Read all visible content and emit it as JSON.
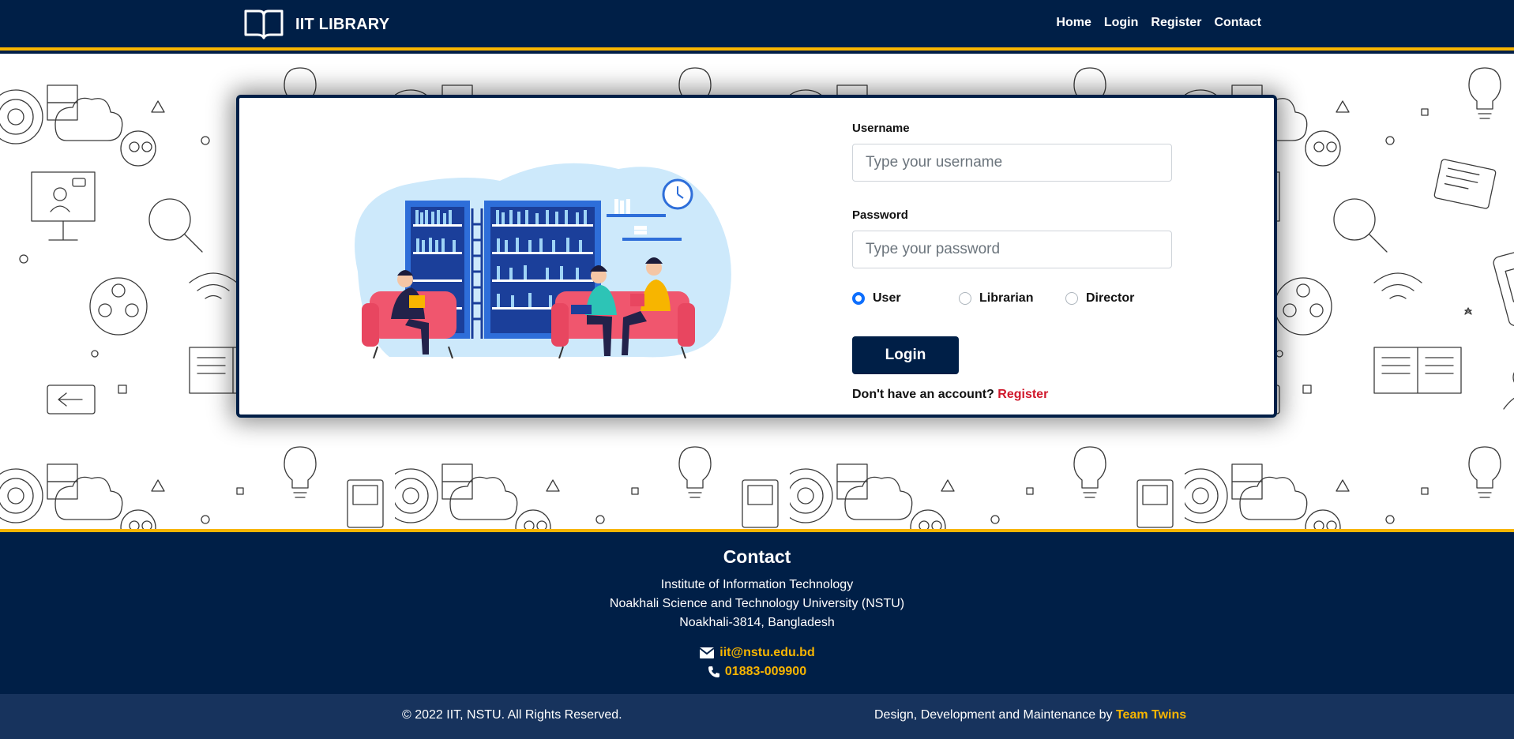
{
  "nav": {
    "brand": "IIT LIBRARY",
    "links": [
      "Home",
      "Login",
      "Register",
      "Contact"
    ]
  },
  "form": {
    "username_label": "Username",
    "username_placeholder": "Type your username",
    "password_label": "Password",
    "password_placeholder": "Type your password",
    "roles": [
      {
        "label": "User",
        "checked": true
      },
      {
        "label": "Librarian",
        "checked": false
      },
      {
        "label": "Director",
        "checked": false
      }
    ],
    "login_button": "Login",
    "signup_prompt": "Don't have an account?",
    "signup_link": "Register"
  },
  "footer": {
    "title": "Contact",
    "address": [
      "Institute of Information Technology",
      "Noakhali Science and Technology University (NSTU)",
      "Noakhali-3814, Bangladesh"
    ],
    "email": "iit@nstu.edu.bd",
    "phone": "01883-009900",
    "copyright": "© 2022 IIT, NSTU. All Rights Reserved.",
    "credit_prefix": "Design, Development and Maintenance by",
    "credit_name": "Team Twins"
  },
  "colors": {
    "navy": "#001f47",
    "accent_yellow": "#f7b500",
    "link_red": "#d0182b",
    "radio_blue": "#0d6efd"
  },
  "icons": [
    "open-book-logo-icon",
    "envelope-icon",
    "phone-icon"
  ]
}
